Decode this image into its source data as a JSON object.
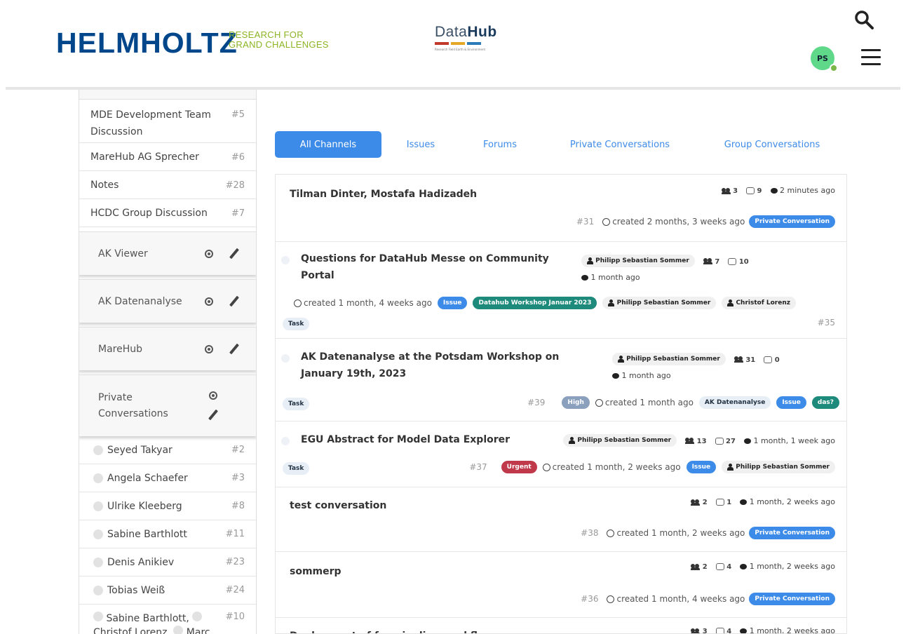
{
  "header": {
    "logo_main": "HELMHOLTZ",
    "logo_sub_line1": "RESEARCH FOR",
    "logo_sub_line2": "GRAND CHALLENGES",
    "datahub_bold": "Data",
    "datahub_rest": "Hub",
    "datahub_tagline": "Research Field Earth & Environment",
    "avatar_initials": "PS",
    "icons": [
      "search-icon",
      "menu-icon"
    ],
    "colors": {
      "brand_blue": "#00468b",
      "brand_green": "#8cb423",
      "accent": "#3d8be8"
    }
  },
  "sidebar": {
    "items": [
      {
        "label": "MDE Development Team Discussion",
        "num": "#5"
      },
      {
        "label": "MareHub AG Sprecher",
        "num": "#6"
      },
      {
        "label": "Notes",
        "num": "#28"
      },
      {
        "label": "HCDC Group Discussion",
        "num": "#7"
      }
    ],
    "groups": [
      {
        "label": "AK Viewer"
      },
      {
        "label": "AK Datenanalyse"
      },
      {
        "label": "MareHub"
      },
      {
        "label": "Private Conversations"
      }
    ],
    "people": [
      {
        "label": "Seyed Takyar",
        "num": "#2"
      },
      {
        "label": "Angela Schaefer",
        "num": "#3"
      },
      {
        "label": "Ulrike Kleeberg",
        "num": "#8"
      },
      {
        "label": "Sabine Barthlott",
        "num": "#11"
      },
      {
        "label": "Denis Anikiev",
        "num": "#23"
      },
      {
        "label": "Tobias Weiß",
        "num": "#24"
      },
      {
        "label": "Sabine Barthlott,",
        "label2": "Christof Lorenz,",
        "label3": "Marc",
        "num": "#10"
      }
    ]
  },
  "tabs": [
    {
      "label": "All Channels",
      "active": true
    },
    {
      "label": "Issues"
    },
    {
      "label": "Forums"
    },
    {
      "label": "Private Conversations"
    },
    {
      "label": "Group Conversations"
    }
  ],
  "rows": [
    {
      "title": "Tilman Dinter, Mostafa Hadizadeh",
      "members": "3",
      "comments": "9",
      "last": "2 minutes ago",
      "num": "#31",
      "created": "created 2 months, 3 weeks ago",
      "tag": "Private Conversation"
    },
    {
      "title": "Questions for DataHub Messe on Community Portal",
      "author": "Philipp Sebastian Sommer",
      "members": "7",
      "comments": "10",
      "last": "1 month ago",
      "created": "created 1 month, 4 weeks ago",
      "tag": "Issue",
      "channel": "Datahub Workshop Januar 2023",
      "assignee1": "Philipp Sebastian Sommer",
      "assignee2": "Christof Lorenz",
      "kind": "Task",
      "num": "#35"
    },
    {
      "title": "AK Datenanalyse at the Potsdam Workshop on January 19th, 2023",
      "author": "Philipp Sebastian Sommer",
      "members": "31",
      "comments": "0",
      "last": "1 month ago",
      "kind": "Task",
      "num": "#39",
      "priority": "High",
      "created": "created 1 month ago",
      "channel": "AK Datenanalyse",
      "tag": "Issue",
      "extra": "das?"
    },
    {
      "title": "EGU Abstract for Model Data Explorer",
      "author": "Philipp Sebastian Sommer",
      "members": "13",
      "comments": "27",
      "last": "1 month, 1 week ago",
      "kind": "Task",
      "num": "#37",
      "priority": "Urgent",
      "created": "created 1 month, 2 weeks ago",
      "tag": "Issue",
      "assignee": "Philipp Sebastian Sommer"
    },
    {
      "title": "test conversation",
      "members": "2",
      "comments": "1",
      "last": "1 month, 2 weeks ago",
      "num": "#38",
      "created": "created 1 month, 2 weeks ago",
      "tag": "Private Conversation"
    },
    {
      "title": "sommerp",
      "members": "2",
      "comments": "4",
      "last": "1 month, 2 weeks ago",
      "num": "#36",
      "created": "created 1 month, 4 weeks ago",
      "tag": "Private Conversation"
    },
    {
      "title": "Deployment of fac-pipeline workflow",
      "members": "3",
      "comments": "4",
      "last": "1 month, 2 weeks ago"
    }
  ]
}
